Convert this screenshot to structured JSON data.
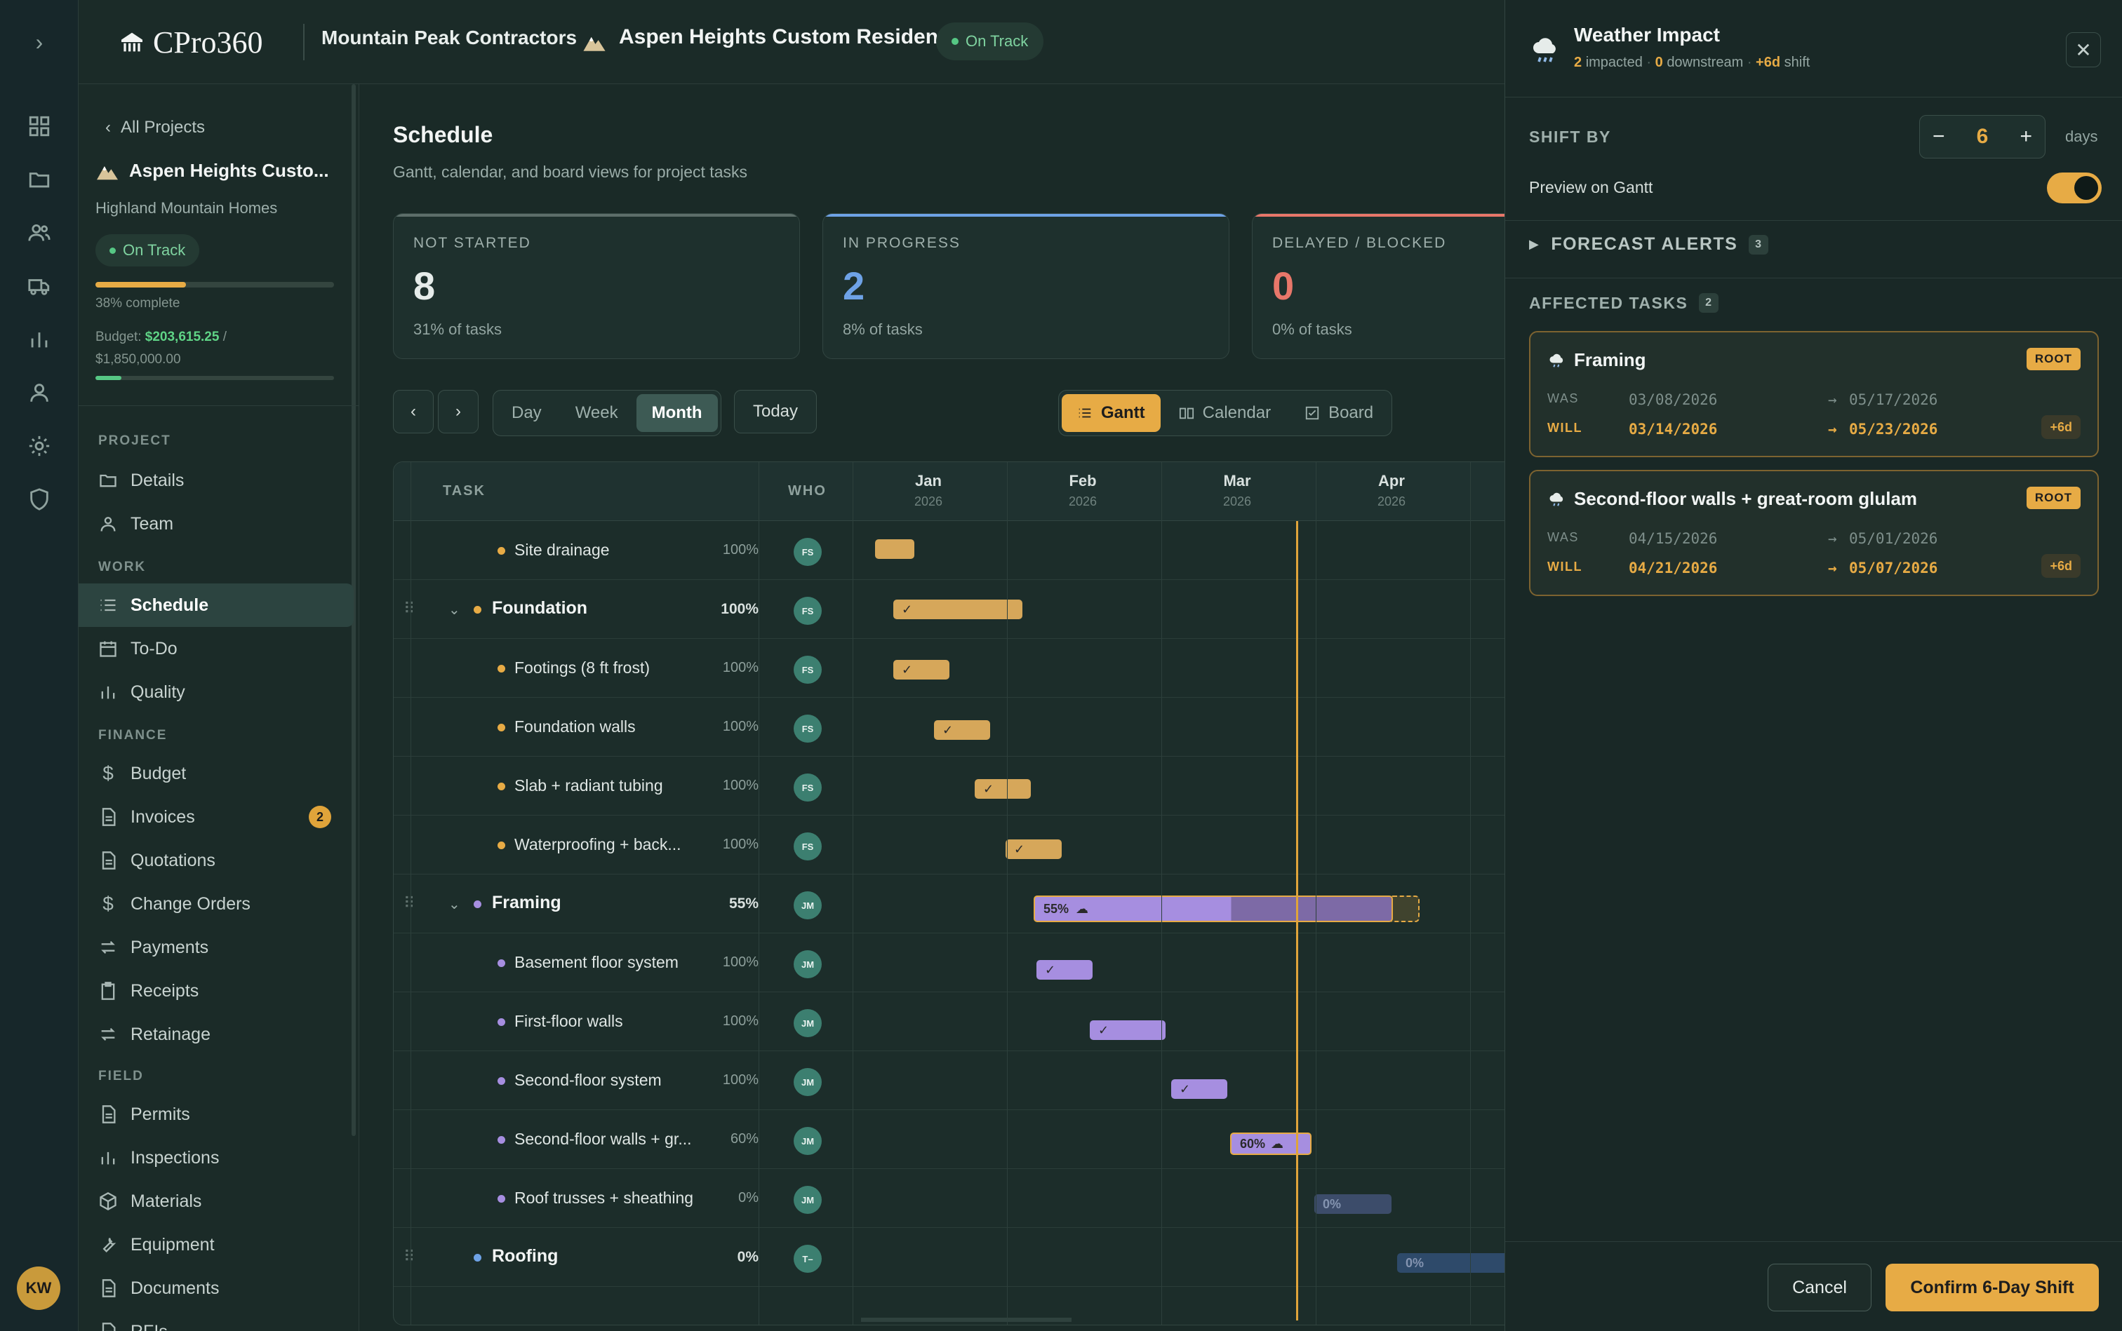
{
  "app": {
    "logo_text": "CPro360",
    "user_initials": "KW"
  },
  "header": {
    "company": "Mountain Peak Contractors",
    "project_title": "Aspen Heights Custom Residence",
    "status": "On Track"
  },
  "sidebar": {
    "back": "All Projects",
    "project_name": "Aspen Heights Custo...",
    "client": "Highland Mountain Homes",
    "status": "On Track",
    "progress": 0.38,
    "progress_text": "38% complete",
    "budget_label": "Budget:",
    "budget_spent": "$203,615.25",
    "budget_sep": " /",
    "budget_total": "$1,850,000.00",
    "budget_progress": 0.11,
    "sections": {
      "project": "PROJECT",
      "work": "WORK",
      "finance": "FINANCE",
      "field": "FIELD"
    },
    "items": {
      "details": "Details",
      "team": "Team",
      "schedule": "Schedule",
      "todo": "To-Do",
      "quality": "Quality",
      "budget": "Budget",
      "invoices": "Invoices",
      "invoices_badge": "2",
      "quotations": "Quotations",
      "change_orders": "Change Orders",
      "payments": "Payments",
      "receipts": "Receipts",
      "retainage": "Retainage",
      "permits": "Permits",
      "inspections": "Inspections",
      "materials": "Materials",
      "equipment": "Equipment",
      "documents": "Documents",
      "rfis": "RFIs"
    }
  },
  "main": {
    "title": "Schedule",
    "subtitle": "Gantt, calendar, and board views for project tasks",
    "stats": [
      {
        "label": "NOT STARTED",
        "value": "8",
        "pct": "31% of tasks",
        "color": "#e6ecea"
      },
      {
        "label": "IN PROGRESS",
        "value": "2",
        "pct": "8% of tasks",
        "color": "#6ea2e6"
      },
      {
        "label": "DELAYED / BLOCKED",
        "value": "0",
        "pct": "0% of tasks",
        "color": "#e8776a"
      }
    ],
    "toolbar": {
      "day": "Day",
      "week": "Week",
      "month": "Month",
      "today": "Today",
      "gantt": "Gantt",
      "calendar": "Calendar",
      "board": "Board"
    }
  },
  "gantt": {
    "col_task": "TASK",
    "col_who": "WHO",
    "months": [
      {
        "m": "Jan",
        "y": "2026"
      },
      {
        "m": "Feb",
        "y": "2026"
      },
      {
        "m": "Mar",
        "y": "2026"
      },
      {
        "m": "Apr",
        "y": "2026"
      }
    ],
    "rows": [
      {
        "name": "Site drainage",
        "pct": "100%",
        "who": "FS",
        "level": 1,
        "dot": "#e7ab45"
      },
      {
        "name": "Foundation",
        "pct": "100%",
        "who": "FS",
        "level": 0,
        "dot": "#e7ab45"
      },
      {
        "name": "Footings (8 ft frost)",
        "pct": "100%",
        "who": "FS",
        "level": 1,
        "dot": "#e7ab45"
      },
      {
        "name": "Foundation walls",
        "pct": "100%",
        "who": "FS",
        "level": 1,
        "dot": "#e7ab45"
      },
      {
        "name": "Slab + radiant tubing",
        "pct": "100%",
        "who": "FS",
        "level": 1,
        "dot": "#e7ab45"
      },
      {
        "name": "Waterproofing + back...",
        "pct": "100%",
        "who": "FS",
        "level": 1,
        "dot": "#e7ab45"
      },
      {
        "name": "Framing",
        "pct": "55%",
        "who": "JM",
        "level": 0,
        "dot": "#a68ee0"
      },
      {
        "name": "Basement floor system",
        "pct": "100%",
        "who": "JM",
        "level": 1,
        "dot": "#a68ee0"
      },
      {
        "name": "First-floor walls",
        "pct": "100%",
        "who": "JM",
        "level": 1,
        "dot": "#a68ee0"
      },
      {
        "name": "Second-floor system",
        "pct": "100%",
        "who": "JM",
        "level": 1,
        "dot": "#a68ee0"
      },
      {
        "name": "Second-floor walls + gr...",
        "pct": "60%",
        "who": "JM",
        "level": 1,
        "dot": "#a68ee0"
      },
      {
        "name": "Roof trusses + sheathing",
        "pct": "0%",
        "who": "JM",
        "level": 1,
        "dot": "#a68ee0"
      },
      {
        "name": "Roofing",
        "pct": "0%",
        "who": "T–",
        "level": 0,
        "dot": "#6ea2e6"
      }
    ],
    "bar_labels": {
      "framing": "55%",
      "second_floor_walls": "60%",
      "roof_trusses": "0%",
      "roofing": "0%",
      "check": "✓"
    }
  },
  "panel": {
    "title": "Weather Impact",
    "impacted": "2",
    "impacted_label": "impacted",
    "downstream": "0",
    "downstream_label": "downstream",
    "shift": "+6d",
    "shift_label": "shift",
    "shift_by": "SHIFT BY",
    "shift_days": "6",
    "days": "days",
    "preview": "Preview on Gantt",
    "forecast": "FORECAST ALERTS",
    "forecast_count": "3",
    "affected": "AFFECTED TASKS",
    "affected_count": "2",
    "tasks": [
      {
        "name": "Framing",
        "tag": "ROOT",
        "was_start": "03/08/2026",
        "was_end": "05/17/2026",
        "will_start": "03/14/2026",
        "will_end": "05/23/2026",
        "delta": "+6d"
      },
      {
        "name": "Second-floor walls + great-room glulam",
        "tag": "ROOT",
        "was_start": "04/15/2026",
        "was_end": "05/01/2026",
        "will_start": "04/21/2026",
        "will_end": "05/07/2026",
        "delta": "+6d"
      }
    ],
    "was_label": "WAS",
    "will_label": "WILL",
    "arrow": "→",
    "cancel": "Cancel",
    "confirm": "Confirm 6-Day Shift"
  },
  "colors": {
    "accent": "#e7ab45",
    "success": "#56c784",
    "framing": "#a68ee0"
  }
}
